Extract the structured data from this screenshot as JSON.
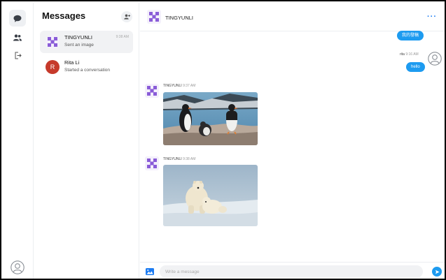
{
  "list": {
    "title": "Messages",
    "conversations": [
      {
        "name": "TINGYUNLI",
        "preview": "Sent an image",
        "time": "9:38 AM"
      },
      {
        "name": "Rita Li",
        "preview": "Started a conversation",
        "initial": "R"
      }
    ]
  },
  "chat": {
    "header_name": "TINGYUNLI",
    "outgoing": [
      {
        "text": "我的發稿"
      },
      {
        "sender": "rita",
        "time": "9:16 AM",
        "text": "hello"
      }
    ],
    "incoming": [
      {
        "sender": "TINGYUNLI",
        "time": "9:37 AM",
        "image": "penguins-photo"
      },
      {
        "sender": "TINGYUNLI",
        "time": "9:38 AM",
        "image": "polar-bears-photo"
      }
    ],
    "composer_placeholder": "Write a message"
  },
  "colors": {
    "accent": "#1d9bf0",
    "brand_purple": "#8a5cd8",
    "avatar_red": "#c63a2b"
  }
}
